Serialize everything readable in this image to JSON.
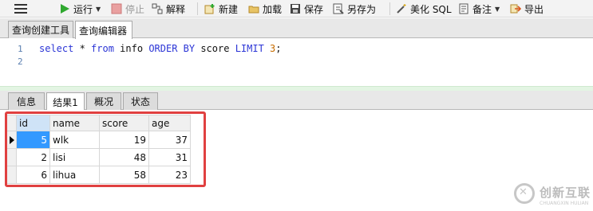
{
  "toolbar": {
    "run": "运行",
    "stop": "停止",
    "explain": "解释",
    "new": "新建",
    "load": "加载",
    "save": "保存",
    "save_as": "另存为",
    "beautify": "美化 SQL",
    "backup": "备注",
    "export": "导出"
  },
  "top_tabs": [
    {
      "label": "查询创建工具",
      "active": false
    },
    {
      "label": "查询编辑器",
      "active": true
    }
  ],
  "editor": {
    "line_numbers": [
      "1",
      "2"
    ],
    "sql": {
      "kw_select": "select",
      "star": " * ",
      "kw_from": "from",
      "table": " info ",
      "kw_order": "ORDER BY",
      "col": " score ",
      "kw_limit": "LIMIT",
      "limit_value": "3",
      "end": ";"
    }
  },
  "result_tabs": [
    {
      "label": "信息",
      "active": false
    },
    {
      "label": "结果1",
      "active": true
    },
    {
      "label": "概况",
      "active": false
    },
    {
      "label": "状态",
      "active": false
    }
  ],
  "grid": {
    "columns": [
      "id",
      "name",
      "score",
      "age"
    ],
    "rows": [
      [
        "5",
        "wlk",
        "19",
        "37"
      ],
      [
        "2",
        "lisi",
        "48",
        "31"
      ],
      [
        "6",
        "lihua",
        "58",
        "23"
      ]
    ]
  },
  "watermark": {
    "brand": "创新互联",
    "sub": "CHUANGXIN HULIAN"
  },
  "colors": {
    "selection": "#3399ff",
    "highlight_box": "#e04040",
    "sql_keyword": "#2b35d6",
    "sql_number": "#c66c00",
    "run_icon": "#2fa82f"
  }
}
